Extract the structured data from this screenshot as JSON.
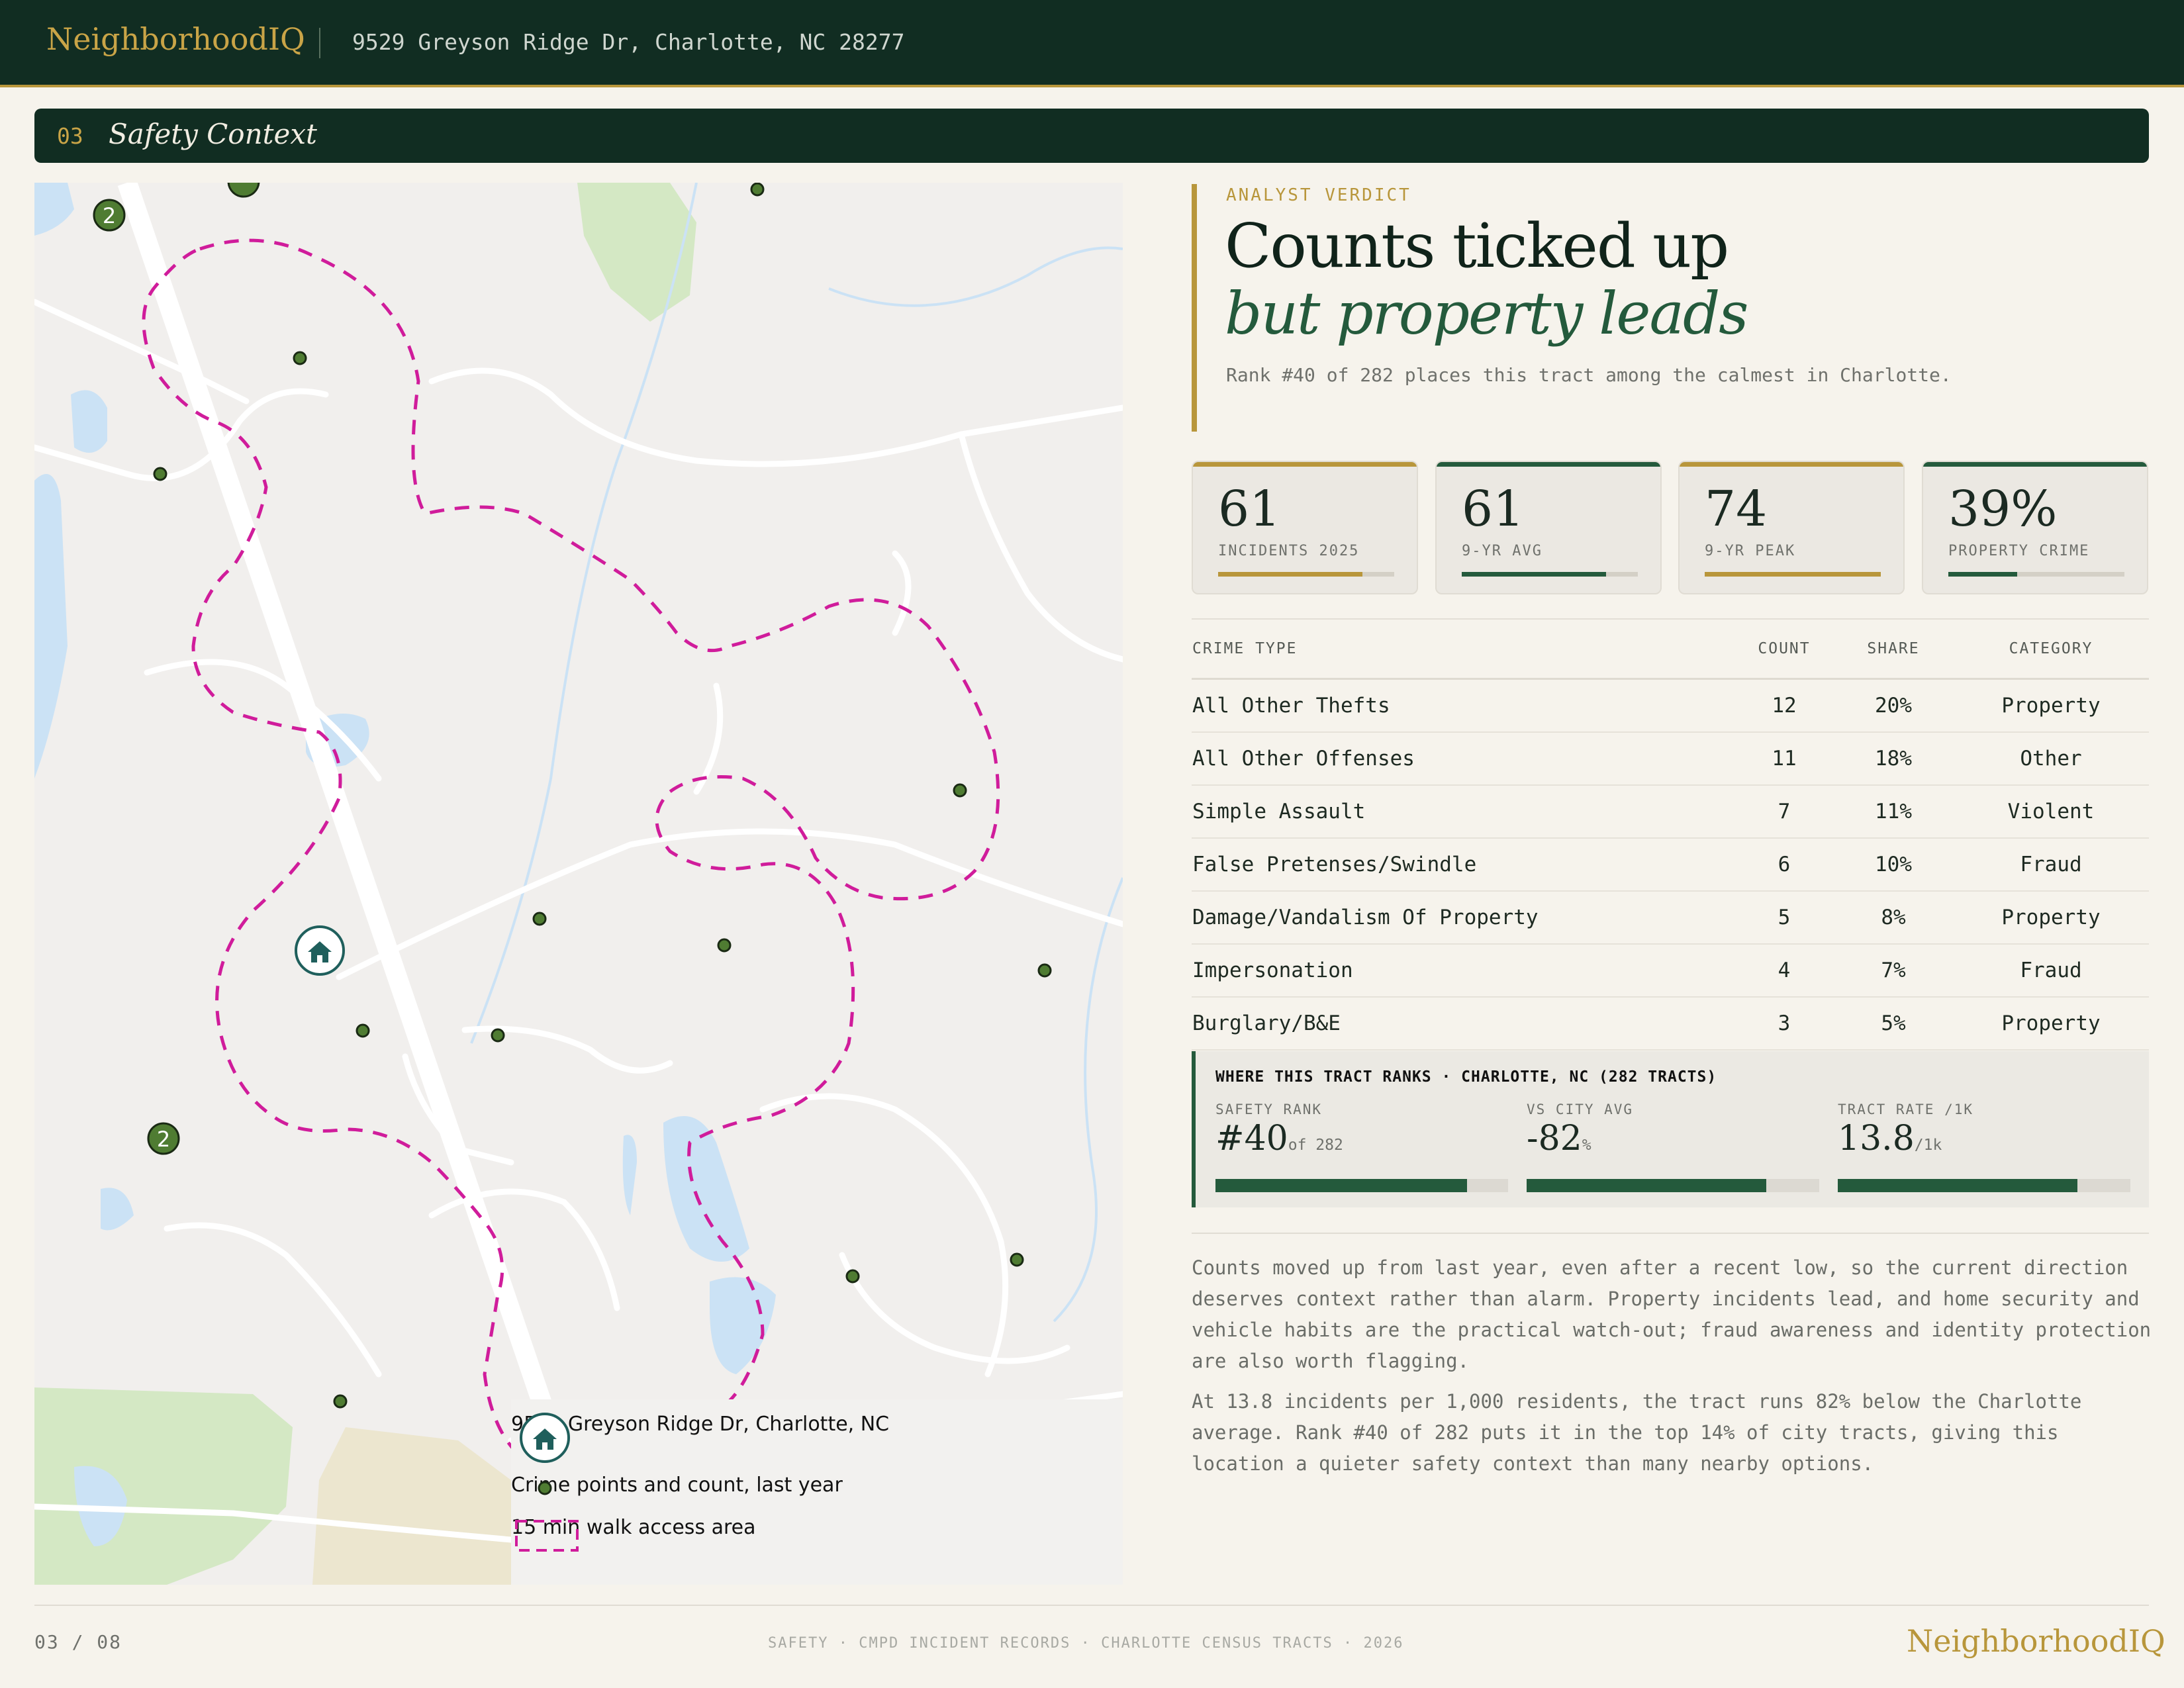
{
  "header": {
    "brand": "NeighborhoodIQ",
    "address": "9529 Greyson Ridge Dr, Charlotte, NC 28277"
  },
  "section": {
    "number": "03",
    "title": "Safety Context"
  },
  "map": {
    "cluster_label": "2",
    "legend": {
      "home": "9529 Greyson Ridge Dr, Charlotte, NC",
      "crime_points": "Crime points and count, last year",
      "walk_area": "15 min walk access area"
    },
    "colors": {
      "walk_area": "#d01c9b",
      "crime_point": "#4f7c32",
      "home_marker": "#1f5f5c",
      "water": "#cbe2f5",
      "park": "#d4e8c4"
    }
  },
  "verdict": {
    "eyebrow": "ANALYST VERDICT",
    "headline_1": "Counts ticked up",
    "headline_2": "but property leads",
    "subline": "Rank #40 of 282 places this tract among the calmest in Charlotte."
  },
  "stats": [
    {
      "value": "61",
      "label": "INCIDENTS 2025",
      "accent": "#b8963b",
      "bar": 0.82
    },
    {
      "value": "61",
      "label": "9-YR AVG",
      "accent": "#245a3c",
      "bar": 0.82
    },
    {
      "value": "74",
      "label": "9-YR PEAK",
      "accent": "#b8963b",
      "bar": 1.0
    },
    {
      "value": "39%",
      "label": "PROPERTY CRIME",
      "accent": "#245a3c",
      "bar": 0.39
    }
  ],
  "crime_table": {
    "headers": [
      "CRIME TYPE",
      "COUNT",
      "SHARE",
      "CATEGORY"
    ],
    "rows": [
      [
        "All Other Thefts",
        "12",
        "20%",
        "Property"
      ],
      [
        "All Other Offenses",
        "11",
        "18%",
        "Other"
      ],
      [
        "Simple Assault",
        "7",
        "11%",
        "Violent"
      ],
      [
        "False Pretenses/Swindle",
        "6",
        "10%",
        "Fraud"
      ],
      [
        "Damage/Vandalism Of Property",
        "5",
        "8%",
        "Property"
      ],
      [
        "Impersonation",
        "4",
        "7%",
        "Fraud"
      ],
      [
        "Burglary/B&E",
        "3",
        "5%",
        "Property"
      ]
    ]
  },
  "ranks": {
    "title": "WHERE THIS TRACT RANKS · CHARLOTTE, NC (282 TRACTS)",
    "items": [
      {
        "label": "SAFETY RANK",
        "value": "#40",
        "unit": "of 282",
        "bar": 0.86
      },
      {
        "label": "VS CITY AVG",
        "value": "-82",
        "unit": "%",
        "bar": 0.82
      },
      {
        "label": "TRACT RATE /1K",
        "value": "13.8",
        "unit": "/1k",
        "bar": 0.82
      }
    ]
  },
  "paragraphs": [
    "Counts moved up from last year, even after a recent low, so the current direction deserves context rather than alarm. Property incidents lead, and home security and vehicle habits are the practical watch-out; fraud awareness and identity protection are also worth flagging.",
    "At 13.8 incidents per 1,000 residents, the tract runs 82% below the Charlotte average. Rank #40 of 282 puts it in the top 14% of city tracts, giving this location a quieter safety context than many nearby options."
  ],
  "footer": {
    "page": "03 / 08",
    "source": "SAFETY · CMPD INCIDENT RECORDS · CHARLOTTE CENSUS TRACTS · 2026",
    "brand": "NeighborhoodIQ"
  }
}
